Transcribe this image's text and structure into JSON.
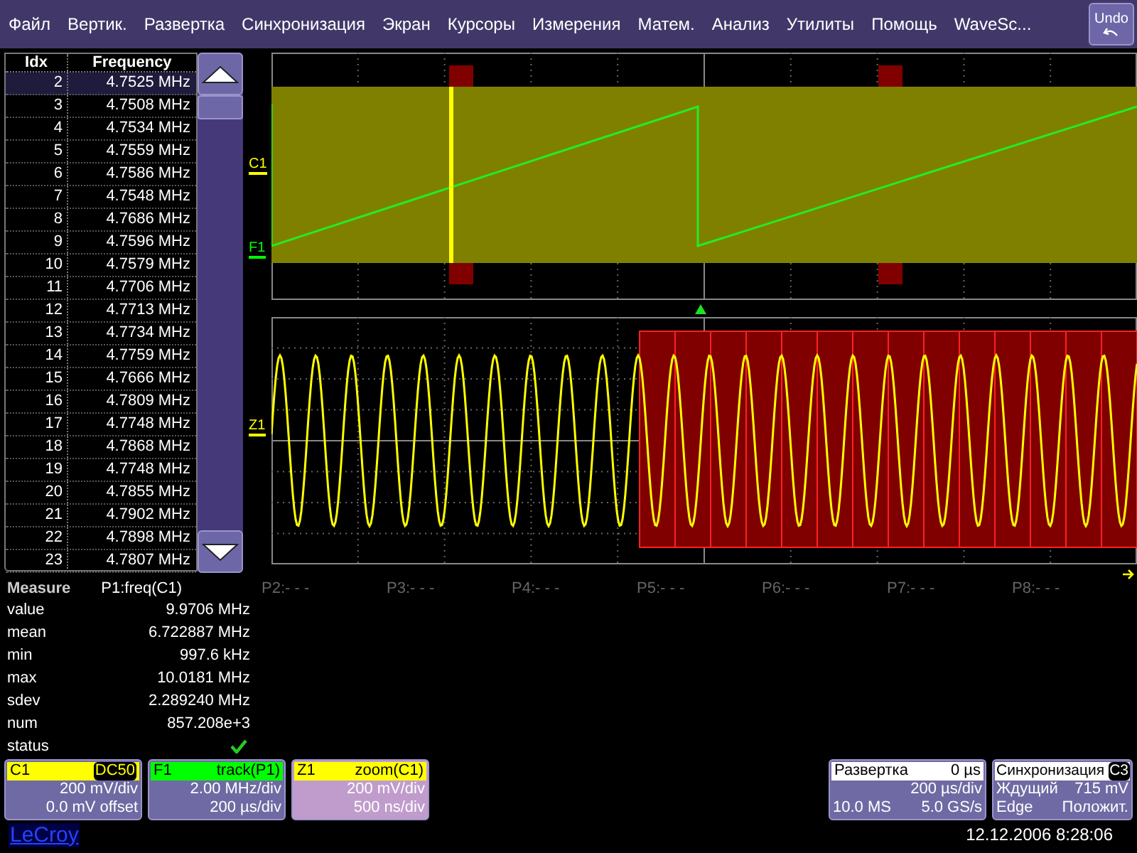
{
  "menu": {
    "items": [
      "Файл",
      "Вертик.",
      "Развертка",
      "Синхронизация",
      "Экран",
      "Курсоры",
      "Измерения",
      "Матем.",
      "Анализ",
      "Утилиты",
      "Помощь",
      "WaveSc..."
    ],
    "undo": "Undo"
  },
  "table": {
    "columns": [
      "Idx",
      "Frequency"
    ],
    "rows": [
      {
        "idx": "2",
        "frequency": "4.7525 MHz",
        "selected": true
      },
      {
        "idx": "3",
        "frequency": "4.7508 MHz",
        "selected": false
      },
      {
        "idx": "4",
        "frequency": "4.7534 MHz",
        "selected": false
      },
      {
        "idx": "5",
        "frequency": "4.7559 MHz",
        "selected": false
      },
      {
        "idx": "6",
        "frequency": "4.7586 MHz",
        "selected": false
      },
      {
        "idx": "7",
        "frequency": "4.7548 MHz",
        "selected": false
      },
      {
        "idx": "8",
        "frequency": "4.7686 MHz",
        "selected": false
      },
      {
        "idx": "9",
        "frequency": "4.7596 MHz",
        "selected": false
      },
      {
        "idx": "10",
        "frequency": "4.7579 MHz",
        "selected": false
      },
      {
        "idx": "11",
        "frequency": "4.7706 MHz",
        "selected": false
      },
      {
        "idx": "12",
        "frequency": "4.7713 MHz",
        "selected": false
      },
      {
        "idx": "13",
        "frequency": "4.7734 MHz",
        "selected": false
      },
      {
        "idx": "14",
        "frequency": "4.7759 MHz",
        "selected": false
      },
      {
        "idx": "15",
        "frequency": "4.7666 MHz",
        "selected": false
      },
      {
        "idx": "16",
        "frequency": "4.7809 MHz",
        "selected": false
      },
      {
        "idx": "17",
        "frequency": "4.7748 MHz",
        "selected": false
      },
      {
        "idx": "18",
        "frequency": "4.7868 MHz",
        "selected": false
      },
      {
        "idx": "19",
        "frequency": "4.7748 MHz",
        "selected": false
      },
      {
        "idx": "20",
        "frequency": "4.7855 MHz",
        "selected": false
      },
      {
        "idx": "21",
        "frequency": "4.7902 MHz",
        "selected": false
      },
      {
        "idx": "22",
        "frequency": "4.7898 MHz",
        "selected": false
      },
      {
        "idx": "23",
        "frequency": "4.7807 MHz",
        "selected": false
      }
    ]
  },
  "trace_labels": {
    "top": [
      {
        "label": "C1",
        "color": "#ffff00"
      },
      {
        "label": "F1",
        "color": "#00ff00"
      }
    ],
    "bottom": [
      {
        "label": "Z1",
        "color": "#ffff00"
      }
    ]
  },
  "measure": {
    "title": "Measure",
    "parameter": "P1:freq(C1)",
    "rows": [
      {
        "label": "value",
        "value": "9.9706 MHz"
      },
      {
        "label": "mean",
        "value": "6.722887 MHz"
      },
      {
        "label": "min",
        "value": "997.6 kHz"
      },
      {
        "label": "max",
        "value": "10.0181 MHz"
      },
      {
        "label": "sdev",
        "value": "2.289240 MHz"
      },
      {
        "label": "num",
        "value": "857.208e+3"
      }
    ],
    "status": {
      "label": "status",
      "ok": true
    }
  },
  "parameters": [
    "P2:- - -",
    "P3:- - -",
    "P4:- - -",
    "P5:- - -",
    "P6:- - -",
    "P7:- - -",
    "P8:- - -"
  ],
  "channels": [
    {
      "name": "C1",
      "tag": "DC50",
      "color": "#ffff00",
      "selected": false,
      "lines": [
        "200 mV/div",
        "0.0 mV offset"
      ]
    },
    {
      "name": "F1",
      "tag": "track(P1)",
      "color": "#00ff00",
      "selected": false,
      "lines": [
        "2.00 MHz/div",
        "200 µs/div"
      ]
    },
    {
      "name": "Z1",
      "tag": "zoom(C1)",
      "color": "#ffff00",
      "selected": true,
      "lines": [
        "200 mV/div",
        "500 ns/div"
      ]
    }
  ],
  "timebase": {
    "title": "Развертка",
    "delay": "0 µs",
    "per_div": "200 µs/div",
    "samples": "10.0 MS",
    "rate": "5.0 GS/s"
  },
  "trigger": {
    "title": "Синхронизация",
    "source": "C3",
    "mode": "Ждущий",
    "level": "715 mV",
    "type": "Edge",
    "slope": "Положит."
  },
  "brand": "LeCroy",
  "datetime": "12.12.2006 8:28:06"
}
